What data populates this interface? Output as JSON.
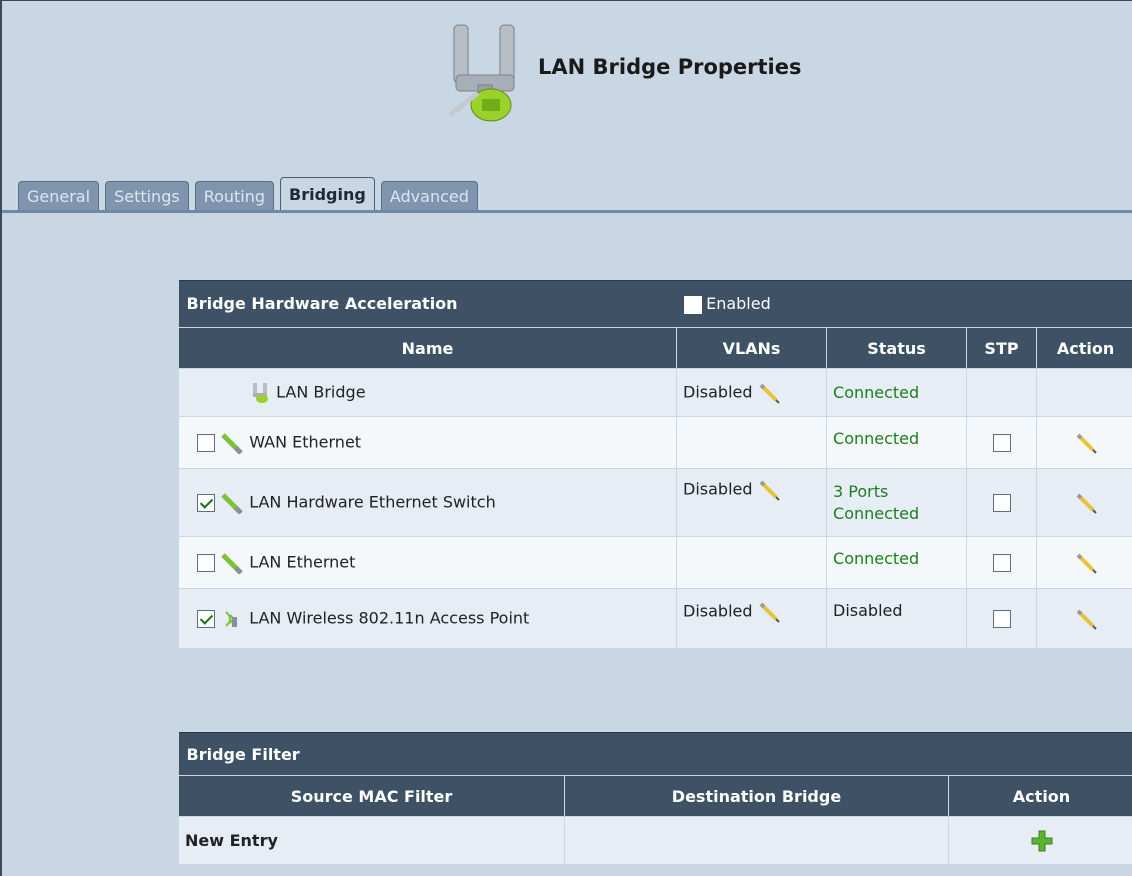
{
  "header": {
    "title": "LAN Bridge Properties"
  },
  "tabs": [
    {
      "label": "General",
      "active": false
    },
    {
      "label": "Settings",
      "active": false
    },
    {
      "label": "Routing",
      "active": false
    },
    {
      "label": "Bridging",
      "active": true
    },
    {
      "label": "Advanced",
      "active": false
    }
  ],
  "bridge_table": {
    "title": "Bridge Hardware Acceleration",
    "enabled_label": "Enabled",
    "enabled_checked": false,
    "columns": [
      "Name",
      "VLANs",
      "Status",
      "STP",
      "Action"
    ],
    "rows": [
      {
        "name": "LAN Bridge",
        "icon": "bridge-icon",
        "checkbox": null,
        "vlans": "Disabled",
        "status": "Connected"
      },
      {
        "name": "WAN Ethernet",
        "icon": "ethernet-cable-icon",
        "checkbox": false,
        "vlans": "",
        "status": "Connected"
      },
      {
        "name": "LAN Hardware Ethernet Switch",
        "icon": "ethernet-cable-icon",
        "checkbox": true,
        "vlans": "Disabled",
        "status_line1": "3 Ports",
        "status_line2": "Connected"
      },
      {
        "name": "LAN Ethernet",
        "icon": "ethernet-cable-icon",
        "checkbox": false,
        "vlans": "",
        "status": "Connected"
      },
      {
        "name": "LAN Wireless 802.11n Access Point",
        "icon": "wireless-icon",
        "checkbox": true,
        "vlans": "Disabled",
        "status": "Disabled"
      }
    ]
  },
  "filter_table": {
    "title": "Bridge Filter",
    "columns": [
      "Source MAC Filter",
      "Destination Bridge",
      "Action"
    ],
    "new_entry_label": "New Entry"
  },
  "colors": {
    "page_bg": "#c9d6e3",
    "header_bar": "#3e5165",
    "connected_text": "#1e7d1e",
    "pencil": "#e8c23a",
    "add_icon": "#5ab52e"
  }
}
